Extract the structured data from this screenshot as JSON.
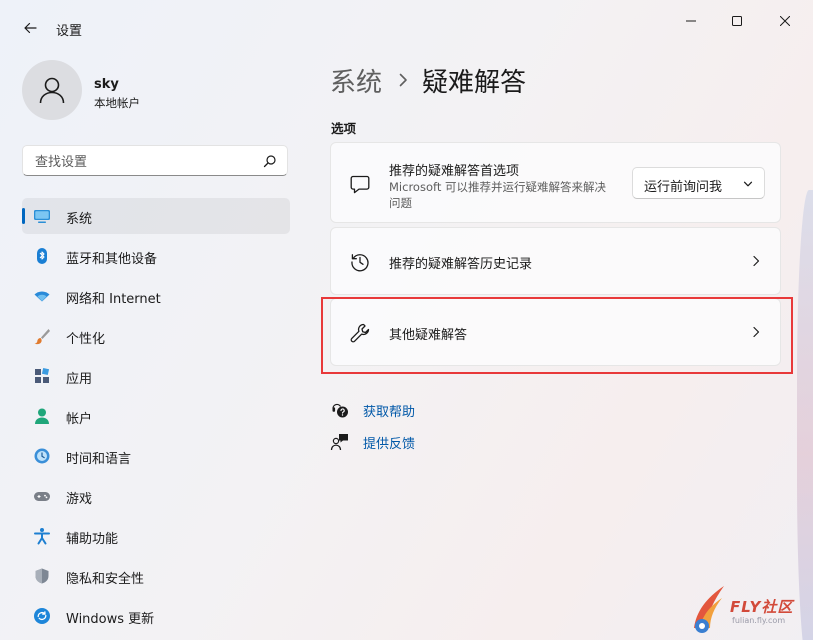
{
  "window": {
    "title": "设置"
  },
  "profile": {
    "name": "sky",
    "account_type": "本地帐户"
  },
  "search": {
    "placeholder": "查找设置"
  },
  "sidebar": {
    "items": [
      {
        "label": "系统",
        "icon": "monitor-icon",
        "active": true
      },
      {
        "label": "蓝牙和其他设备",
        "icon": "bluetooth-icon"
      },
      {
        "label": "网络和 Internet",
        "icon": "wifi-icon"
      },
      {
        "label": "个性化",
        "icon": "brush-icon"
      },
      {
        "label": "应用",
        "icon": "apps-icon"
      },
      {
        "label": "帐户",
        "icon": "person-icon"
      },
      {
        "label": "时间和语言",
        "icon": "clock-globe-icon"
      },
      {
        "label": "游戏",
        "icon": "gamepad-icon"
      },
      {
        "label": "辅助功能",
        "icon": "accessibility-icon"
      },
      {
        "label": "隐私和安全性",
        "icon": "shield-icon"
      },
      {
        "label": "Windows 更新",
        "icon": "update-icon"
      }
    ]
  },
  "breadcrumb": {
    "parent": "系统",
    "current": "疑难解答"
  },
  "section": {
    "label": "选项"
  },
  "cards": {
    "preferences": {
      "title": "推荐的疑难解答首选项",
      "description": "Microsoft 可以推荐并运行疑难解答来解决问题",
      "icon": "chat-bubble-icon",
      "dropdown_value": "运行前询问我"
    },
    "history": {
      "title": "推荐的疑难解答历史记录",
      "icon": "history-icon"
    },
    "other": {
      "title": "其他疑难解答",
      "icon": "wrench-icon"
    }
  },
  "links": {
    "help": {
      "label": "获取帮助",
      "icon": "help-icon"
    },
    "feedback": {
      "label": "提供反馈",
      "icon": "feedback-icon"
    }
  },
  "watermark": {
    "text": "FLY社区",
    "sub": "fulian.fly.com"
  },
  "colors": {
    "accent": "#0067c0",
    "link": "#0058a8",
    "highlight": "#e8393a"
  }
}
